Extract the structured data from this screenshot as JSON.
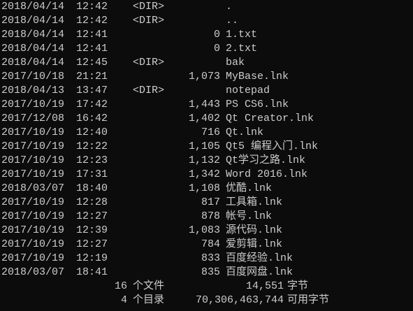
{
  "window": {
    "background": "#0c0c0c",
    "foreground": "#cccccc"
  },
  "entries": [
    {
      "date": "2018/04/14",
      "time": "12:42",
      "dir": "<DIR>",
      "size": "",
      "name": "."
    },
    {
      "date": "2018/04/14",
      "time": "12:42",
      "dir": "<DIR>",
      "size": "",
      "name": ".."
    },
    {
      "date": "2018/04/14",
      "time": "12:41",
      "dir": "",
      "size": "0",
      "name": "1.txt"
    },
    {
      "date": "2018/04/14",
      "time": "12:41",
      "dir": "",
      "size": "0",
      "name": "2.txt"
    },
    {
      "date": "2018/04/14",
      "time": "12:45",
      "dir": "<DIR>",
      "size": "",
      "name": "bak"
    },
    {
      "date": "2017/10/18",
      "time": "21:21",
      "dir": "",
      "size": "1,073",
      "name": "MyBase.lnk"
    },
    {
      "date": "2018/04/13",
      "time": "13:47",
      "dir": "<DIR>",
      "size": "",
      "name": "notepad"
    },
    {
      "date": "2017/10/19",
      "time": "17:42",
      "dir": "",
      "size": "1,443",
      "name": "PS CS6.lnk"
    },
    {
      "date": "2017/12/08",
      "time": "16:42",
      "dir": "",
      "size": "1,402",
      "name": "Qt Creator.lnk"
    },
    {
      "date": "2017/10/19",
      "time": "12:40",
      "dir": "",
      "size": "716",
      "name": "Qt.lnk"
    },
    {
      "date": "2017/10/19",
      "time": "12:22",
      "dir": "",
      "size": "1,105",
      "name": "Qt5 编程入门.lnk"
    },
    {
      "date": "2017/10/19",
      "time": "12:23",
      "dir": "",
      "size": "1,132",
      "name": "Qt学习之路.lnk"
    },
    {
      "date": "2017/10/19",
      "time": "17:31",
      "dir": "",
      "size": "1,342",
      "name": "Word 2016.lnk"
    },
    {
      "date": "2018/03/07",
      "time": "18:40",
      "dir": "",
      "size": "1,108",
      "name": "优酷.lnk"
    },
    {
      "date": "2017/10/19",
      "time": "12:28",
      "dir": "",
      "size": "817",
      "name": "工具箱.lnk"
    },
    {
      "date": "2017/10/19",
      "time": "12:27",
      "dir": "",
      "size": "878",
      "name": "帐号.lnk"
    },
    {
      "date": "2017/10/19",
      "time": "12:39",
      "dir": "",
      "size": "1,083",
      "name": "源代码.lnk"
    },
    {
      "date": "2017/10/19",
      "time": "12:27",
      "dir": "",
      "size": "784",
      "name": "爱剪辑.lnk"
    },
    {
      "date": "2017/10/19",
      "time": "12:19",
      "dir": "",
      "size": "833",
      "name": "百度经验.lnk"
    },
    {
      "date": "2018/03/07",
      "time": "18:41",
      "dir": "",
      "size": "835",
      "name": "百度网盘.lnk"
    }
  ],
  "summary": {
    "files_count": "16",
    "files_label": "个文件",
    "files_bytes": "14,551",
    "files_unit": "字节",
    "dirs_count": "4",
    "dirs_label": "个目录",
    "dirs_bytes": "70,306,463,744",
    "dirs_unit": "可用字节"
  }
}
